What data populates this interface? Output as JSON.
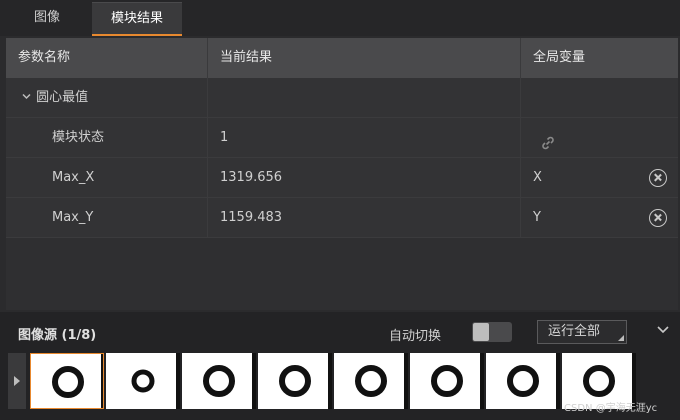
{
  "tabs": [
    {
      "label": "图像"
    },
    {
      "label": "模块结果"
    }
  ],
  "table": {
    "headers": [
      "参数名称",
      "当前结果",
      "全局变量"
    ],
    "group": {
      "label": "圆心最值"
    },
    "rows": [
      {
        "name": "模块状态",
        "value": "1",
        "global": ""
      },
      {
        "name": "Max_X",
        "value": "1319.656",
        "global": "X"
      },
      {
        "name": "Max_Y",
        "value": "1159.483",
        "global": "Y"
      }
    ]
  },
  "source": {
    "title": "图像源 (1/8)",
    "auto_switch_label": "自动切换",
    "auto_switch_on": false,
    "run_button": "运行全部",
    "thumbnail_count": 8,
    "selected_index": 0
  },
  "watermark": "CSDN @宇海无涯yc",
  "colors": {
    "accent": "#e8892f",
    "background": "#2b2b2d",
    "header": "#4a4a4c"
  },
  "icons": {
    "link": "link-icon",
    "delete": "circle-x-icon",
    "collapse": "chevron-down-icon"
  }
}
